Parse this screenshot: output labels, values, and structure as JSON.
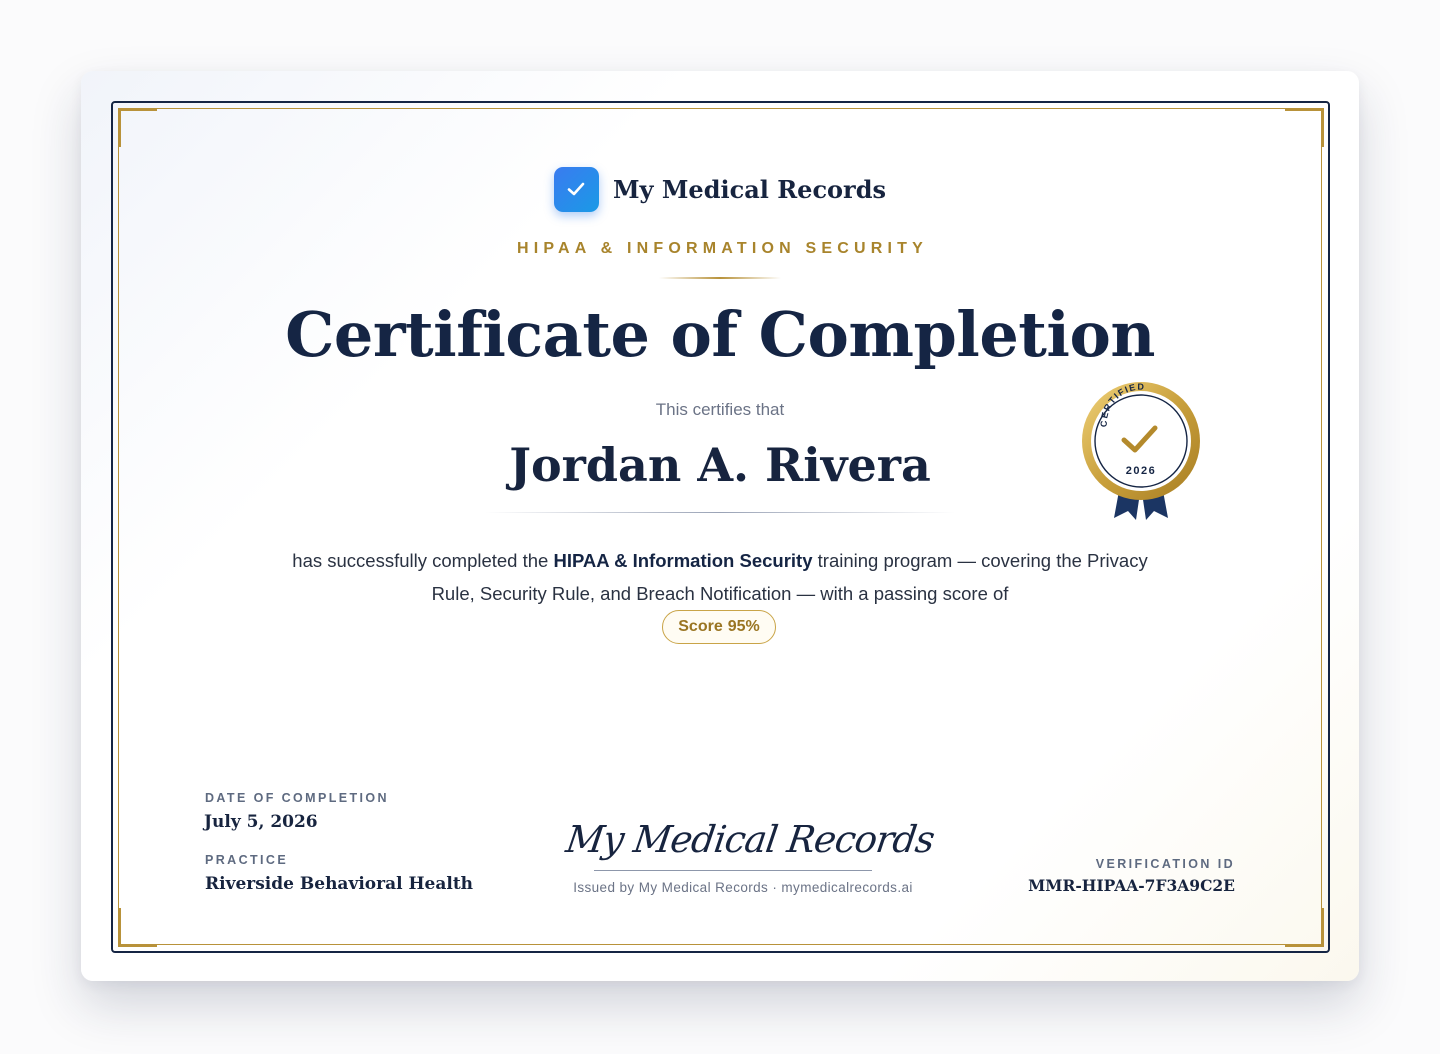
{
  "brand": {
    "name": "My Medical Records",
    "icon": "checkmark-icon",
    "icon_color": "#2f86ee"
  },
  "certificate": {
    "eyebrow": "HIPAA & INFORMATION SECURITY",
    "title": "Certificate of Completion",
    "certifies": "This certifies that",
    "recipient": "Jordan A. Rivera",
    "body_part1": "has successfully completed the ",
    "course_name": "HIPAA & Information Security",
    "body_part2": " training program — covering the Privacy Rule, Security Rule, and Breach Notification — with a passing score of",
    "score_label": "Score",
    "score_value": "95%"
  },
  "seal": {
    "text": "CERTIFIED",
    "year": "2026",
    "icon": "checkmark-icon"
  },
  "details": {
    "date_label": "DATE OF COMPLETION",
    "date_value": "July 5, 2026",
    "practice_label": "PRACTICE",
    "practice_value": "Riverside Behavioral Health",
    "verification_label": "VERIFICATION ID",
    "verification_value": "MMR-HIPAA-7F3A9C2E"
  },
  "signature": {
    "text": "My Medical Records",
    "issued_by": "Issued by My Medical Records · mymedicalrecords.ai"
  },
  "colors": {
    "navy": "#152544",
    "gold": "#b8923a",
    "text": "#2a3242",
    "muted": "#6b7386"
  }
}
